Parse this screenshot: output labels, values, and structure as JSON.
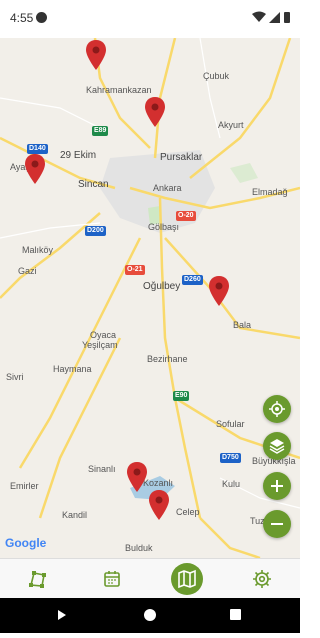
{
  "status_bar": {
    "time": "4:55"
  },
  "map": {
    "places": {
      "cubuk": "Çubuk",
      "kahramankazan": "Kahramankazan",
      "akyurt": "Akyurt",
      "ekim29": "29 Ekim",
      "ayas": "Ayaş",
      "sincan": "Sincan",
      "pursaklar": "Pursaklar",
      "ankara": "Ankara",
      "elmadag": "Elmadağ",
      "malikoy": "Malıköy",
      "gazi": "Gazi",
      "golbasi": "Gölbaşı",
      "ogulbey": "Oğulbey",
      "bala": "Bala",
      "oyaca": "Oyaca",
      "yesilcam": "Yeşilçam",
      "bezirhane": "Bezirhane",
      "haymana": "Haymana",
      "sivri": "Sivri",
      "sofular": "Sofular",
      "buyukkisla": "Büyükkışla",
      "sinanli": "Sinanlı",
      "kulu": "Kulu",
      "kozanli": "Kozanlı",
      "emirler": "Emirler",
      "kandil": "Kandil",
      "bulduk": "Bulduk",
      "celep": "Celep",
      "tuzyaka": "Tuzyaka"
    },
    "route_shields": {
      "e89": "E89",
      "d140": "D140",
      "d200": "D200",
      "o20": "O-20",
      "o21": "O-21",
      "d260": "D260",
      "e90": "E90",
      "d750": "D750"
    },
    "attribution": "Google",
    "colors": {
      "pin": "#d32f2f",
      "accent": "#6a9a2d",
      "road": "#f9d96b",
      "water": "#a9cce3"
    }
  },
  "controls": {
    "icons": [
      "my-location-icon",
      "layers-icon",
      "zoom-in-icon",
      "zoom-out-icon"
    ]
  },
  "bottom_nav": {
    "items": [
      "route-icon",
      "calendar-icon",
      "map-icon",
      "settings-icon"
    ],
    "active": "map-icon"
  }
}
